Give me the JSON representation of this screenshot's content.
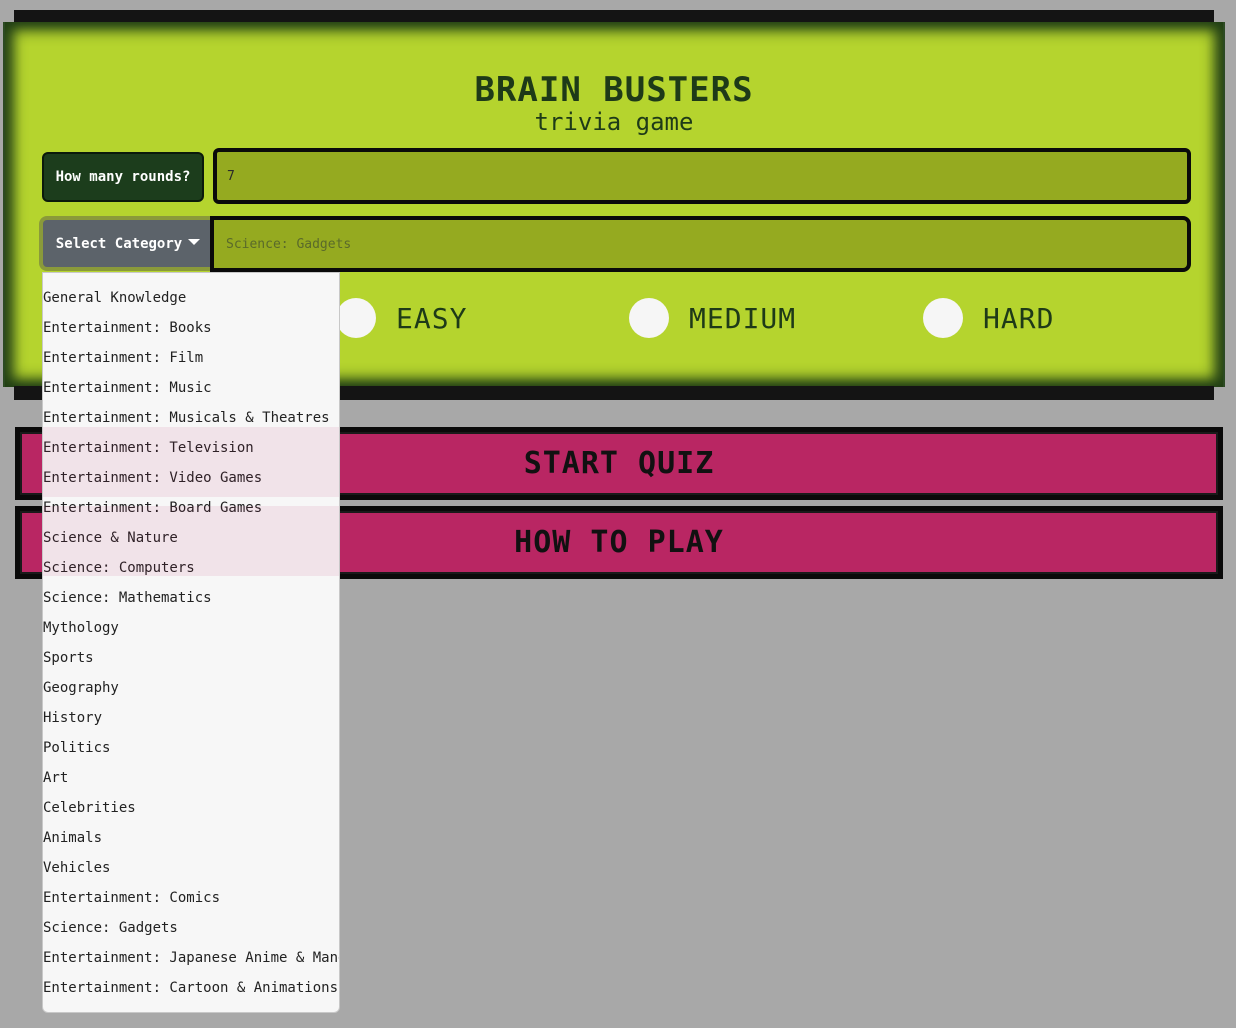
{
  "header": {
    "title": "BRAIN BUSTERS",
    "subtitle": "trivia game"
  },
  "rounds": {
    "label": "How many rounds?",
    "value": "7"
  },
  "category": {
    "button_label": "Select Category",
    "selected": "Science: Gadgets"
  },
  "difficulty": {
    "options": [
      "EASY",
      "MEDIUM",
      "HARD"
    ]
  },
  "actions": {
    "start_label": "START QUIZ",
    "howto_label": "HOW TO PLAY"
  },
  "dropdown": {
    "items": [
      "General Knowledge",
      "Entertainment: Books",
      "Entertainment: Film",
      "Entertainment: Music",
      "Entertainment: Musicals & Theatres",
      "Entertainment: Television",
      "Entertainment: Video Games",
      "Entertainment: Board Games",
      "Science & Nature",
      "Science: Computers",
      "Science: Mathematics",
      "Mythology",
      "Sports",
      "Geography",
      "History",
      "Politics",
      "Art",
      "Celebrities",
      "Animals",
      "Vehicles",
      "Entertainment: Comics",
      "Science: Gadgets",
      "Entertainment: Japanese Anime & Manga",
      "Entertainment: Cartoon & Animations"
    ]
  },
  "colors": {
    "card": "#b5d42e",
    "accent_dark": "#1c3d1c",
    "button_pink": "#b92663",
    "input_olive": "#95aa20"
  }
}
